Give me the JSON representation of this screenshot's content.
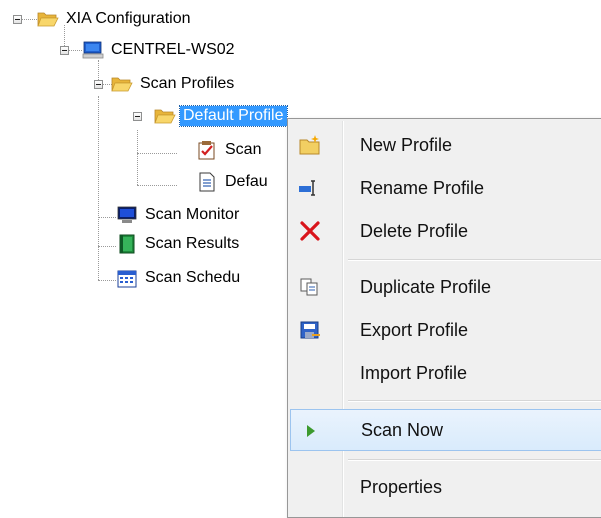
{
  "tree": {
    "root": {
      "label": "XIA Configuration",
      "icon": "folder-open-icon"
    },
    "computer": {
      "label": "CENTREL-WS02",
      "icon": "computer-icon"
    },
    "scan_profiles": {
      "label": "Scan Profiles",
      "icon": "folder-open-icon"
    },
    "default_profile": {
      "label": "Default Profile",
      "icon": "folder-open-icon",
      "selected": true
    },
    "child_scan": {
      "label": "Scan",
      "icon": "checklist-icon"
    },
    "child_default": {
      "label": "Defau",
      "icon": "document-icon"
    },
    "scan_monitor": {
      "label": "Scan Monitor",
      "icon": "monitor-icon"
    },
    "scan_results": {
      "label": "Scan Results",
      "icon": "book-icon"
    },
    "scan_schedule": {
      "label": "Scan Schedu",
      "icon": "calendar-icon"
    }
  },
  "context_menu": {
    "items": [
      {
        "label": "New Profile",
        "icon": "new-folder-icon"
      },
      {
        "label": "Rename Profile",
        "icon": "rename-icon"
      },
      {
        "label": "Delete Profile",
        "icon": "delete-x-icon"
      },
      {
        "label": "Duplicate Profile",
        "icon": "duplicate-icon"
      },
      {
        "label": "Export Profile",
        "icon": "export-icon"
      },
      {
        "label": "Import Profile",
        "icon": ""
      },
      {
        "label": "Scan Now",
        "icon": "play-icon",
        "highlighted": true
      },
      {
        "label": "Properties",
        "icon": ""
      }
    ]
  },
  "colors": {
    "selection": "#3399ff",
    "menu_background": "#f0f0f0",
    "menu_highlight": "#d9ebfc",
    "play_green": "#3c9a2e",
    "delete_red": "#d9141b"
  }
}
